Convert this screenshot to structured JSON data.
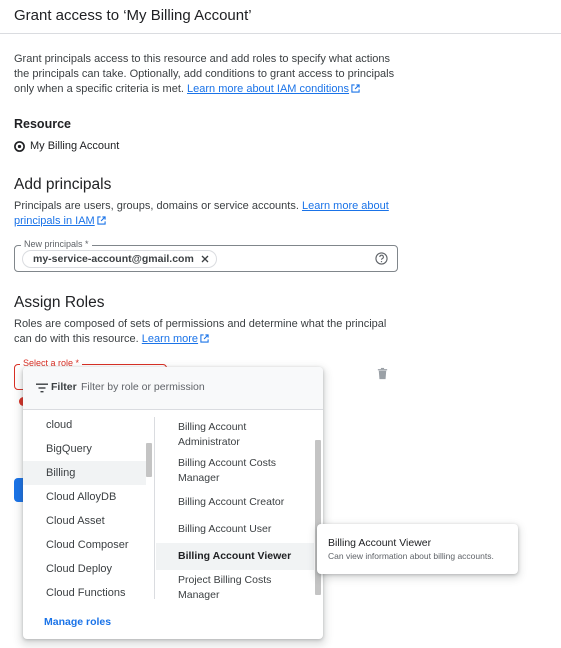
{
  "header": {
    "title": "Grant access to ‘My Billing Account’"
  },
  "intro": {
    "text": "Grant principals access to this resource and add roles to specify what actions the principals can take. Optionally, add conditions to grant access to principals only when a specific criteria is met.",
    "link": "Learn more about IAM conditions"
  },
  "resource": {
    "heading": "Resource",
    "name": "My Billing Account"
  },
  "add_principals": {
    "heading": "Add principals",
    "desc": "Principals are users, groups, domains or service accounts.",
    "link": "Learn more about principals in IAM",
    "field_label": "New principals *",
    "chip": "my-service-account@gmail.com"
  },
  "assign_roles": {
    "heading": "Assign Roles",
    "desc": "Roles are composed of sets of permissions and determine what the principal can do with this resource.",
    "link": "Learn more",
    "field_label": "Select a role *"
  },
  "dropdown": {
    "filter_label": "Filter",
    "filter_placeholder": "Filter by role or permission",
    "categories": [
      "cloud",
      "BigQuery",
      "Billing",
      "Cloud AlloyDB",
      "Cloud Asset",
      "Cloud Composer",
      "Cloud Deploy",
      "Cloud Functions"
    ],
    "selected_category": "Billing",
    "roles": [
      "Billing Account Administrator",
      "Billing Account Costs Manager",
      "Billing Account Creator",
      "Billing Account User",
      "Billing Account Viewer",
      "Project Billing Costs Manager"
    ],
    "selected_role": "Billing Account Viewer",
    "manage_roles": "Manage roles"
  },
  "tooltip": {
    "title": "Billing Account Viewer",
    "desc": "Can view information about billing accounts."
  },
  "colors": {
    "accent": "#1a73e8",
    "error": "#d93025",
    "text": "#202124",
    "muted": "#5f6368"
  }
}
